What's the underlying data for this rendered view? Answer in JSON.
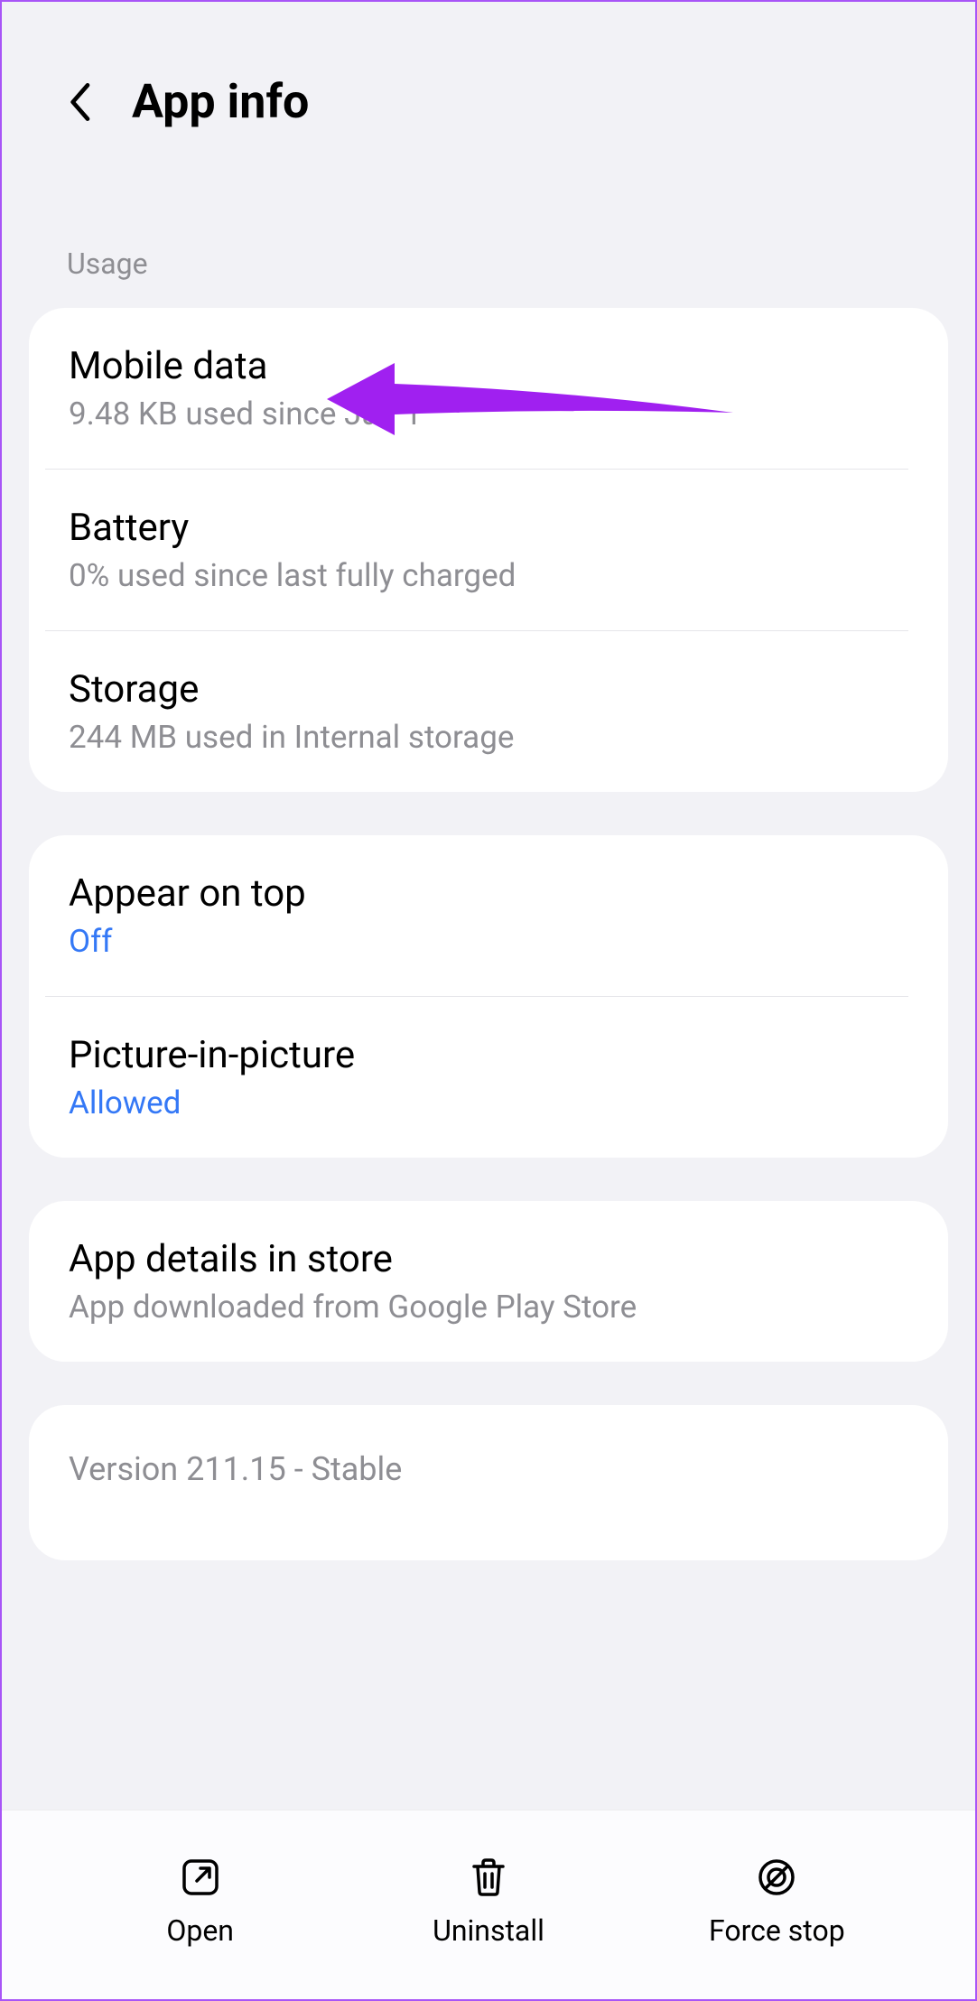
{
  "header": {
    "title": "App info"
  },
  "sections": {
    "usage_label": "Usage"
  },
  "usage_items": {
    "mobile_data": {
      "title": "Mobile data",
      "subtitle": "9.48 KB used since Jan 1"
    },
    "battery": {
      "title": "Battery",
      "subtitle": "0% used since last fully charged"
    },
    "storage": {
      "title": "Storage",
      "subtitle": "244 MB used in Internal storage"
    }
  },
  "permission_items": {
    "appear_on_top": {
      "title": "Appear on top",
      "status": "Off"
    },
    "picture_in_picture": {
      "title": "Picture-in-picture",
      "status": "Allowed"
    }
  },
  "store_item": {
    "title": "App details in store",
    "subtitle": "App downloaded from Google Play Store"
  },
  "version": "Version 211.15 - Stable",
  "bottom_actions": {
    "open": "Open",
    "uninstall": "Uninstall",
    "force_stop": "Force stop"
  }
}
